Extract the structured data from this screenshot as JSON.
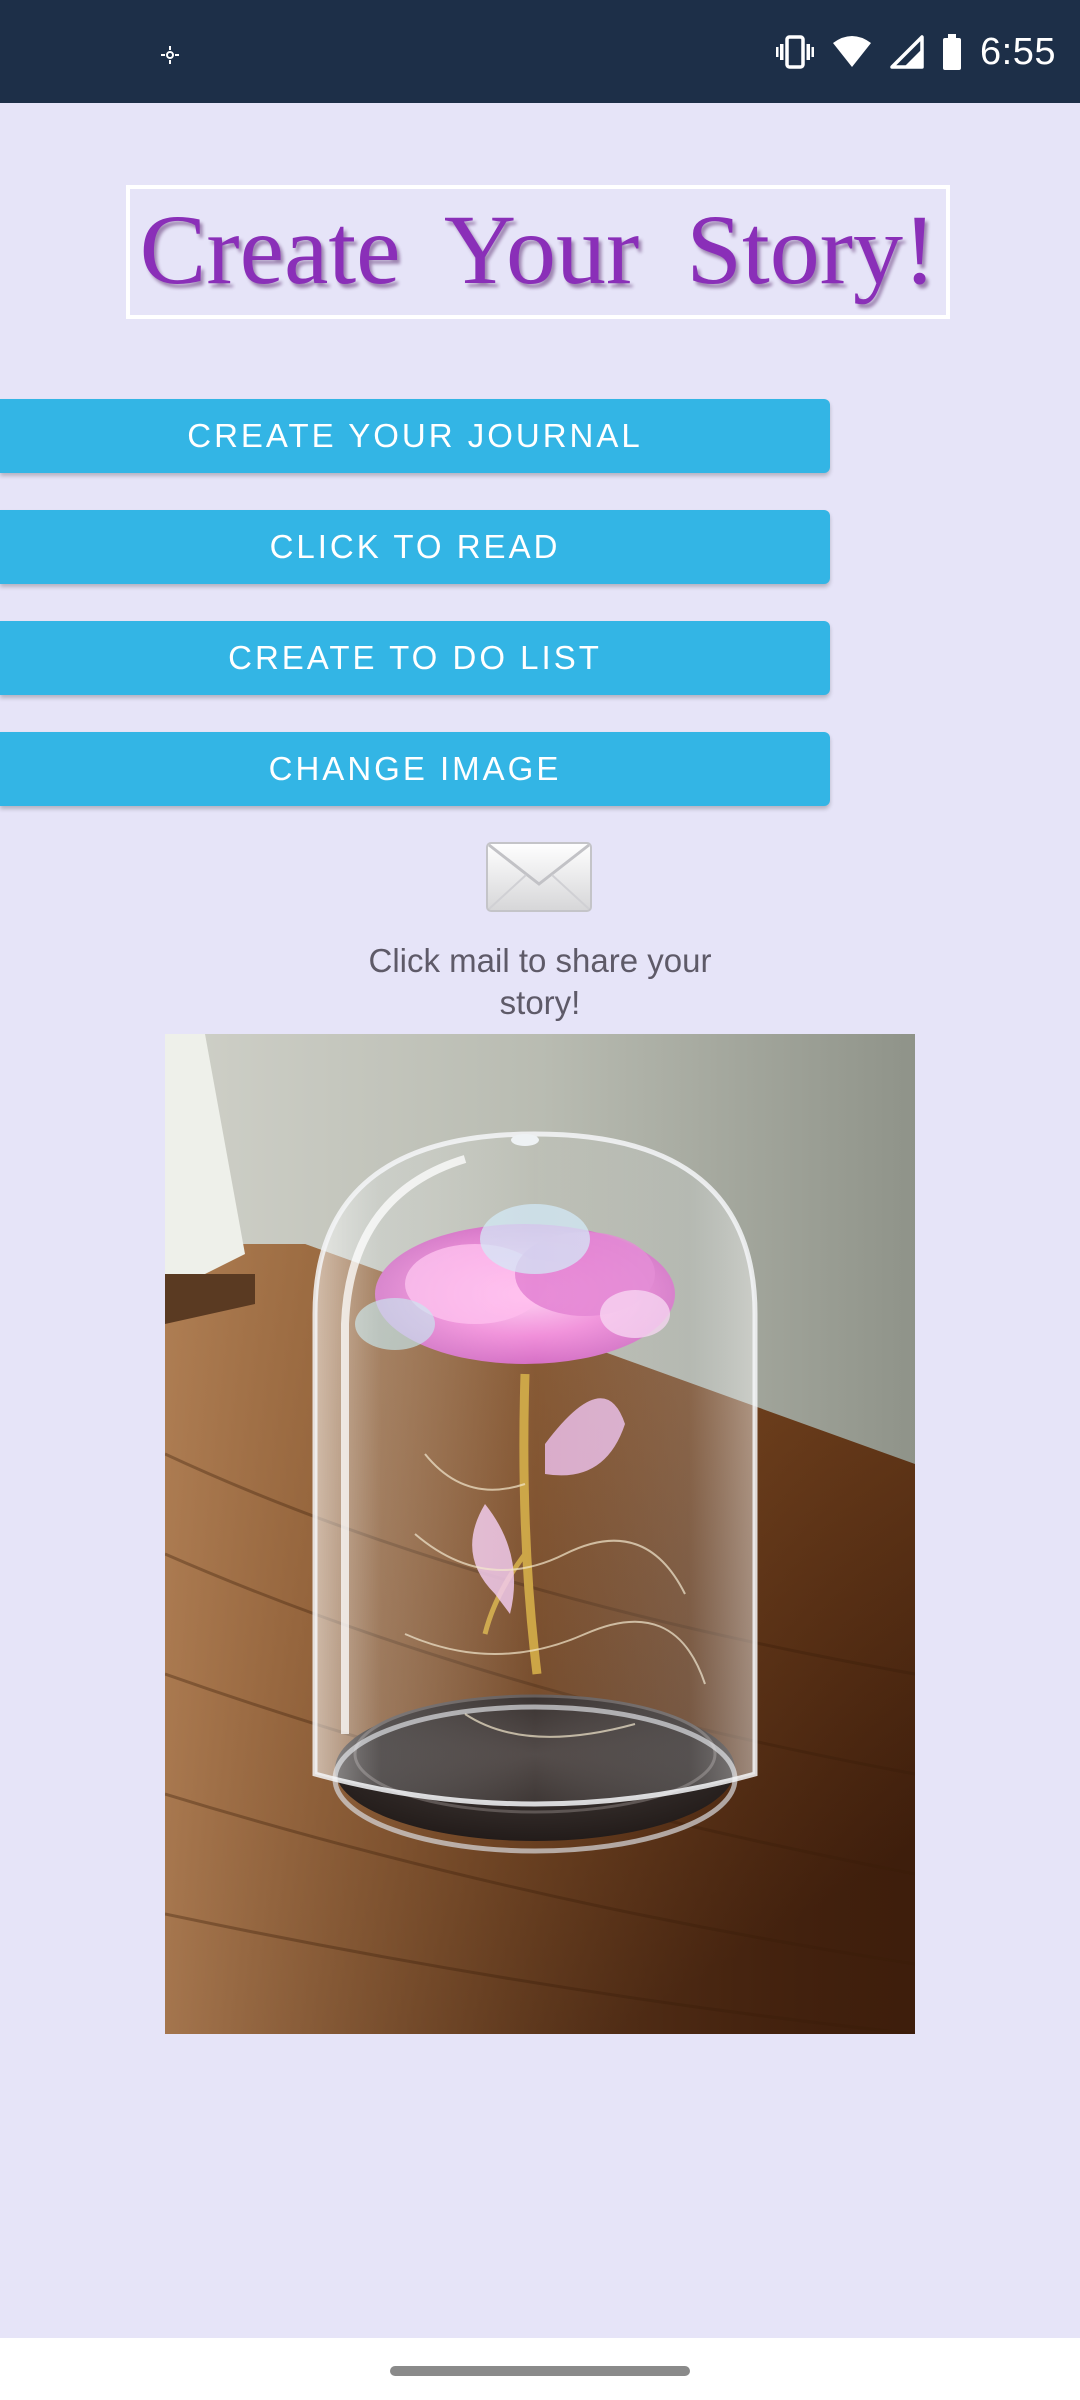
{
  "status_bar": {
    "time": "6:55",
    "left_icon": "gear-notification-icon",
    "icons": [
      "vibrate-icon",
      "wifi-icon",
      "signal-icon",
      "battery-icon"
    ],
    "background": "#1d2f48"
  },
  "title": {
    "text": "Create Your Story!",
    "color": "#8a2fb8"
  },
  "buttons": {
    "journal": "CREATE YOUR JOURNAL",
    "read": "CLICK TO READ",
    "todo": "CREATE TO DO LIST",
    "change_image": "CHANGE IMAGE",
    "color": "#33b5e5"
  },
  "share": {
    "icon": "mail-icon",
    "text": "Click mail to share your story!"
  },
  "photo": {
    "subject": "rose-in-glass-dome-image"
  },
  "colors": {
    "background": "#e6e4f8",
    "text_secondary": "#5e5a68"
  }
}
